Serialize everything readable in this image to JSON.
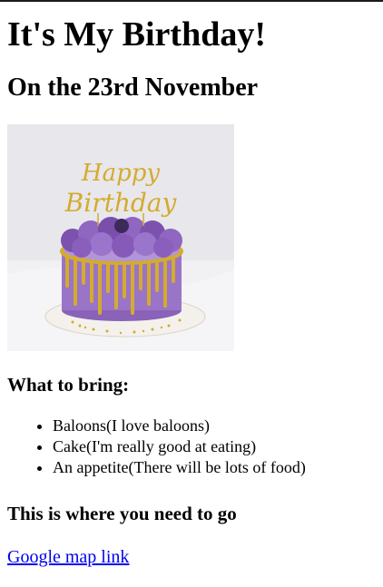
{
  "page": {
    "title": "It's My Birthday!",
    "date_heading": "On the 23rd November",
    "cake_image": {
      "icon": "birthday-cake-photo",
      "topper_text": "Happy Birthday",
      "colors": {
        "background": "#e6e6ea",
        "frosting": "#8a62b8",
        "drip": "#d4ab2f",
        "board": "#f4f1ec"
      }
    },
    "bring_heading": "What to bring:",
    "bring_items": [
      "Baloons(I love baloons)",
      "Cake(I'm really good at eating)",
      "An appetite(There will be lots of food)"
    ],
    "location_heading": "This is where you need to go",
    "map_link_text": "Google map link",
    "colors": {
      "link": "#0000ee",
      "text": "#000000",
      "top_border": "#1a1a1a"
    }
  }
}
